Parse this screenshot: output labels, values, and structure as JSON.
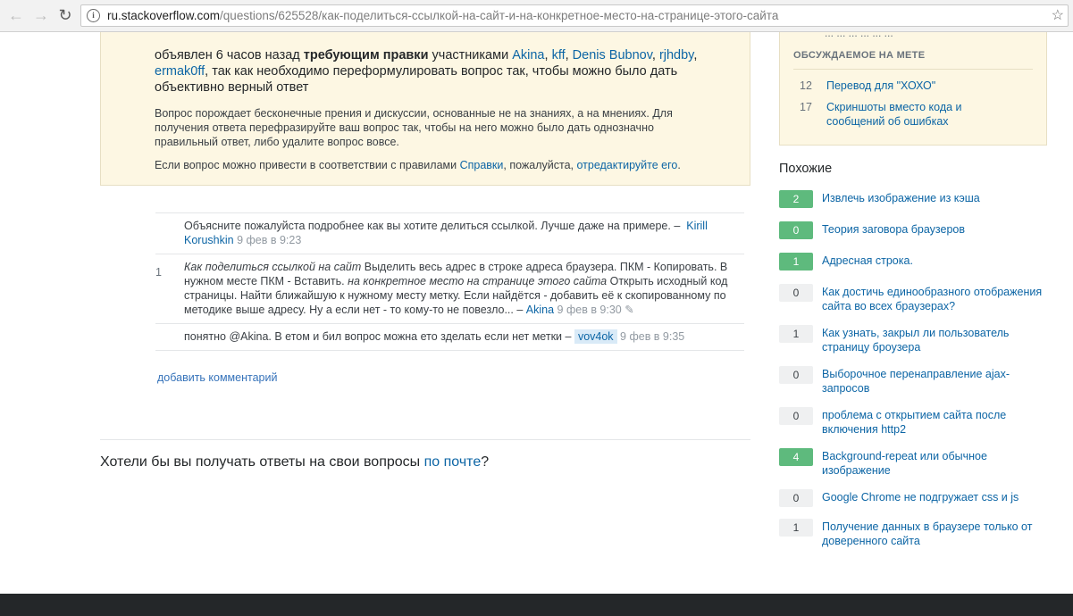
{
  "browser": {
    "url_host": "ru.stackoverflow.com",
    "url_path": "/questions/625528/как-поделиться-ссылкой-на-сайт-и-на-конкретное-место-на-странице-этого-сайта",
    "back_icon": "arrow-left-icon",
    "forward_icon": "arrow-right-icon",
    "reload_icon": "reload-icon",
    "info_icon": "info-icon",
    "star_icon": "star-icon"
  },
  "notice": {
    "prefix": "объявлен 6 часов назад ",
    "bold": "требующим правки",
    "middle": " участниками ",
    "users": [
      "Akina",
      "kff",
      "Denis Bubnov",
      "rjhdby",
      "ermak0ff"
    ],
    "suffix": ", так как необходимо переформулировать вопрос так, чтобы можно было дать объективно верный ответ",
    "explanation": "Вопрос порождает бесконечные прения и дискуссии, основанные не на знаниях, а на мнениях. Для получения ответа перефразируйте ваш вопрос так, чтобы на него можно было дать однозначно правильный ответ, либо удалите вопрос вовсе.",
    "edit_prefix": "Если вопрос можно привести в соответствии с правилами ",
    "help_link": "Справки",
    "edit_middle": ", пожалуйста, ",
    "edit_link": "отредактируйте его",
    "edit_suffix": "."
  },
  "comments": [
    {
      "score": "",
      "text": "Объясните пожалуйста подробнее как вы хотите делиться ссылкой. Лучше даже на примере. –",
      "user": "Kirill Korushkin",
      "date": "9 фев в 9:23"
    },
    {
      "score": "1",
      "italic1": "Как поделиться ссылкой на сайт",
      "text1": " Выделить весь адрес в строке адреса браузера. ПКМ - Копировать. В нужном месте ПКМ - Вставить. ",
      "italic2": "на конкретное место на странице этого сайта",
      "text2": " Открыть исходный код страницы. Найти ближайшую к нужному месту метку. Если найдётся - добавить её к скопированному по методике выше адресу. Ну а если нет - то кому-то не повезло... –",
      "user": "Akina",
      "date": "9 фев в 9:30",
      "edit_icon": "pencil-icon"
    },
    {
      "score": "",
      "text": "понятно @Akina. В етом и бил вопрос можна ето зделать если нет метки –",
      "user": "vov4ok",
      "date": "9 фев в 9:35"
    }
  ],
  "add_comment": "добавить комментарий",
  "email_prompt": {
    "prefix": "Хотели бы вы получать ответы на свои вопросы ",
    "link": "по почте",
    "suffix": "?"
  },
  "sidebar": {
    "cut_text": "... ... ... ... ... ...",
    "meta_title": "ОБСУЖДАЕМОЕ НА МЕТЕ",
    "meta_items": [
      {
        "num": "12",
        "title": "Перевод для \"ХОХО\""
      },
      {
        "num": "17",
        "title": "Скриншоты вместо кода и сообщений об ошибках"
      }
    ],
    "related_title": "Похожие",
    "related": [
      {
        "count": "2",
        "answered": true,
        "title": "Извлечь изображение из кэша"
      },
      {
        "count": "0",
        "answered": true,
        "title": "Теория заговора браузеров"
      },
      {
        "count": "1",
        "answered": true,
        "title": "Адресная строка."
      },
      {
        "count": "0",
        "answered": false,
        "title": "Как достичь единообразного отображения сайта во всех браузерах?"
      },
      {
        "count": "1",
        "answered": false,
        "title": "Как узнать, закрыл ли пользователь страницу броузера"
      },
      {
        "count": "0",
        "answered": false,
        "title": "Выборочное перенаправление ajax-запросов"
      },
      {
        "count": "0",
        "answered": false,
        "title": "проблема с открытием сайта после включения http2"
      },
      {
        "count": "4",
        "answered": true,
        "title": "Background-repeat или обычное изображение"
      },
      {
        "count": "0",
        "answered": false,
        "title": "Google Chrome не подгружает css и js"
      },
      {
        "count": "1",
        "answered": false,
        "title": "Получение данных в браузере только от доверенного сайта"
      }
    ]
  }
}
